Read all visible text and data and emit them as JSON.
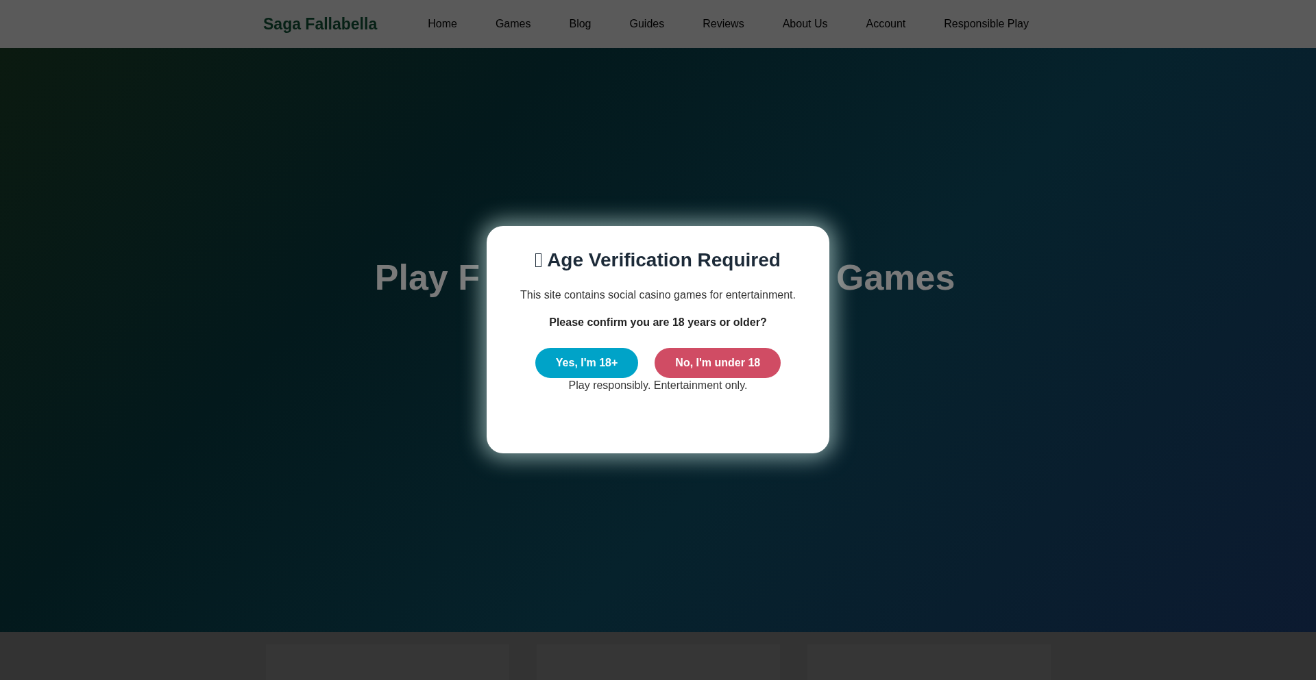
{
  "header": {
    "logo": "Saga Fallabella",
    "nav": [
      "Home",
      "Games",
      "Blog",
      "Guides",
      "Reviews",
      "About Us",
      "Account",
      "Responsible Play"
    ]
  },
  "hero": {
    "title_left": "Play F",
    "title_right": "Games"
  },
  "modal": {
    "title": "Age Verification Required",
    "text": "This site contains social casino games for entertainment.",
    "question": "Please confirm you are 18 years or older?",
    "buttons": [
      {
        "label": "Yes, I'm 18+",
        "kind": "confirm"
      },
      {
        "label": "No, I'm under 18",
        "kind": "deny"
      }
    ],
    "footnote": "Play responsibly. Entertainment only."
  }
}
